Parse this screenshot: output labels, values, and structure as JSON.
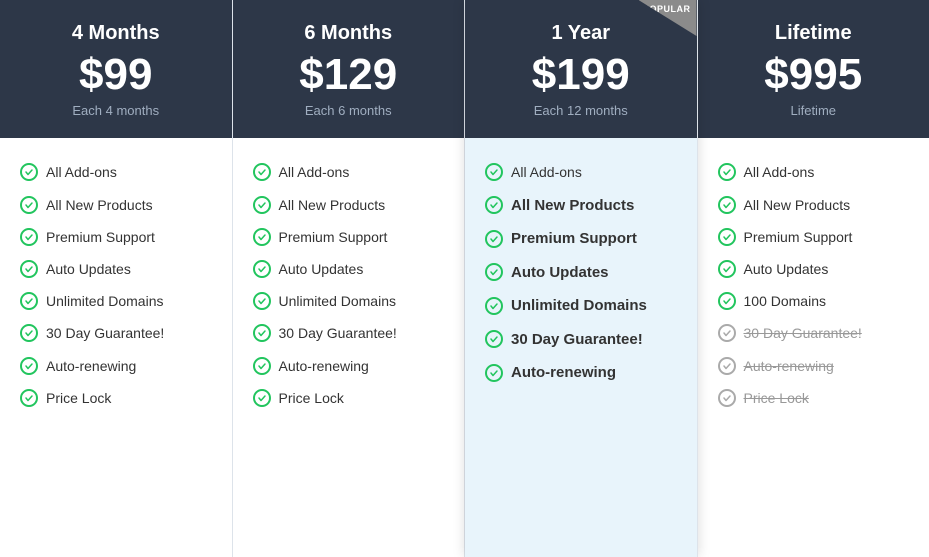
{
  "plans": [
    {
      "id": "4months",
      "title": "4 Months",
      "price": "$99",
      "period": "Each 4 months",
      "featured": false,
      "badge": null,
      "features": [
        {
          "id": "addons",
          "label": "All Add-ons",
          "active": true,
          "strikethrough": false
        },
        {
          "id": "new-products",
          "label": "All New Products",
          "active": true,
          "strikethrough": false
        },
        {
          "id": "premium-support",
          "label": "Premium Support",
          "active": true,
          "strikethrough": false
        },
        {
          "id": "auto-updates",
          "label": "Auto Updates",
          "active": true,
          "strikethrough": false
        },
        {
          "id": "unlimited-domains",
          "label": "Unlimited Domains",
          "active": true,
          "strikethrough": false
        },
        {
          "id": "guarantee",
          "label": "30 Day Guarantee!",
          "active": true,
          "strikethrough": false
        },
        {
          "id": "auto-renewing",
          "label": "Auto-renewing",
          "active": true,
          "strikethrough": false
        },
        {
          "id": "price-lock",
          "label": "Price Lock",
          "active": true,
          "strikethrough": false
        }
      ]
    },
    {
      "id": "6months",
      "title": "6 Months",
      "price": "$129",
      "period": "Each 6 months",
      "featured": false,
      "badge": null,
      "features": [
        {
          "id": "addons",
          "label": "All Add-ons",
          "active": true,
          "strikethrough": false
        },
        {
          "id": "new-products",
          "label": "All New Products",
          "active": true,
          "strikethrough": false
        },
        {
          "id": "premium-support",
          "label": "Premium Support",
          "active": true,
          "strikethrough": false
        },
        {
          "id": "auto-updates",
          "label": "Auto Updates",
          "active": true,
          "strikethrough": false
        },
        {
          "id": "unlimited-domains",
          "label": "Unlimited Domains",
          "active": true,
          "strikethrough": false
        },
        {
          "id": "guarantee",
          "label": "30 Day Guarantee!",
          "active": true,
          "strikethrough": false
        },
        {
          "id": "auto-renewing",
          "label": "Auto-renewing",
          "active": true,
          "strikethrough": false
        },
        {
          "id": "price-lock",
          "label": "Price Lock",
          "active": true,
          "strikethrough": false
        }
      ]
    },
    {
      "id": "1year",
      "title": "1 Year",
      "price": "$199",
      "period": "Each 12 months",
      "featured": true,
      "badge": "POPULAR",
      "features": [
        {
          "id": "addons",
          "label": "All Add-ons",
          "active": true,
          "strikethrough": false
        },
        {
          "id": "new-products",
          "label": "All New Products",
          "active": true,
          "strikethrough": false,
          "bold": true
        },
        {
          "id": "premium-support",
          "label": "Premium Support",
          "active": true,
          "strikethrough": false,
          "bold": true
        },
        {
          "id": "auto-updates",
          "label": "Auto Updates",
          "active": true,
          "strikethrough": false,
          "bold": true
        },
        {
          "id": "unlimited-domains",
          "label": "Unlimited Domains",
          "active": true,
          "strikethrough": false,
          "bold": true
        },
        {
          "id": "guarantee",
          "label": "30 Day Guarantee!",
          "active": true,
          "strikethrough": false,
          "bold": true
        },
        {
          "id": "auto-renewing",
          "label": "Auto-renewing",
          "active": true,
          "strikethrough": false,
          "bold": true
        }
      ]
    },
    {
      "id": "lifetime",
      "title": "Lifetime",
      "price": "$995",
      "period": "Lifetime",
      "featured": false,
      "badge": null,
      "features": [
        {
          "id": "addons",
          "label": "All Add-ons",
          "active": true,
          "strikethrough": false
        },
        {
          "id": "new-products",
          "label": "All New Products",
          "active": true,
          "strikethrough": false
        },
        {
          "id": "premium-support",
          "label": "Premium Support",
          "active": true,
          "strikethrough": false
        },
        {
          "id": "auto-updates",
          "label": "Auto Updates",
          "active": true,
          "strikethrough": false
        },
        {
          "id": "100-domains",
          "label": "100 Domains",
          "active": true,
          "strikethrough": false
        },
        {
          "id": "guarantee",
          "label": "30 Day Guarantee!",
          "active": false,
          "strikethrough": true
        },
        {
          "id": "auto-renewing",
          "label": "Auto-renewing",
          "active": false,
          "strikethrough": true
        },
        {
          "id": "price-lock",
          "label": "Price Lock",
          "active": false,
          "strikethrough": true
        }
      ]
    }
  ]
}
